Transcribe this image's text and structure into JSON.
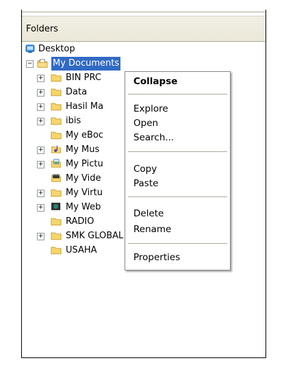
{
  "panel": {
    "header": "Folders"
  },
  "tree": {
    "root": "Desktop",
    "items": [
      {
        "label": "My Documents",
        "icon": "documents-folder-icon",
        "expander": "−"
      },
      {
        "label": "BIN PRC",
        "icon": "folder-icon",
        "expander": "+"
      },
      {
        "label": "Data",
        "icon": "folder-icon",
        "expander": "+"
      },
      {
        "label": "Hasil Ma",
        "icon": "folder-icon",
        "expander": "+"
      },
      {
        "label": "ibis",
        "icon": "folder-icon",
        "expander": "+"
      },
      {
        "label": "My eBoc",
        "icon": "folder-icon",
        "expander": ""
      },
      {
        "label": "My Mus",
        "icon": "music-folder-icon",
        "expander": "+"
      },
      {
        "label": "My Pictu",
        "icon": "pictures-folder-icon",
        "expander": "+"
      },
      {
        "label": "My Vide",
        "icon": "video-folder-icon",
        "expander": ""
      },
      {
        "label": "My Virtu",
        "icon": "folder-icon",
        "expander": "+"
      },
      {
        "label": "My Web",
        "icon": "web-folder-icon",
        "expander": "+"
      },
      {
        "label": "RADIO",
        "icon": "folder-icon",
        "expander": ""
      },
      {
        "label": "SMK GLOBAL",
        "icon": "folder-icon",
        "expander": "+"
      },
      {
        "label": "USAHA",
        "icon": "folder-icon",
        "expander": ""
      }
    ]
  },
  "context_menu": {
    "items": [
      {
        "label": "Collapse",
        "bold": true
      },
      {
        "label": "Explore"
      },
      {
        "label": "Open"
      },
      {
        "label": "Search..."
      },
      {
        "label": "Copy"
      },
      {
        "label": "Paste"
      },
      {
        "label": "Delete"
      },
      {
        "label": "Rename"
      },
      {
        "label": "Properties"
      }
    ]
  },
  "colors": {
    "selection": "#316ac5",
    "folder": "#f5d66b",
    "folder_dark": "#d8a83a"
  }
}
